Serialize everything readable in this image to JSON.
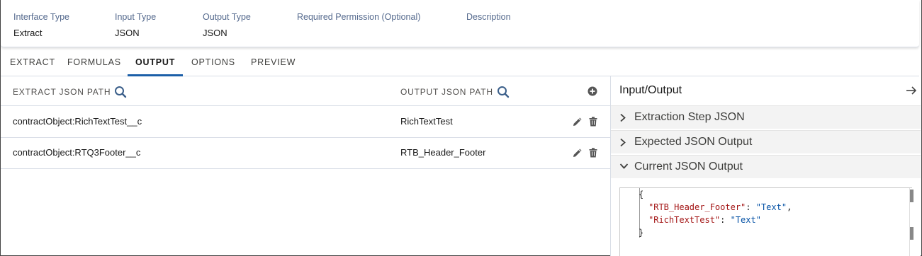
{
  "header": {
    "fields": [
      {
        "label": "Interface Type",
        "value": "Extract"
      },
      {
        "label": "Input Type",
        "value": "JSON"
      },
      {
        "label": "Output Type",
        "value": "JSON"
      },
      {
        "label": "Required Permission (Optional)",
        "value": ""
      },
      {
        "label": "Description",
        "value": ""
      }
    ]
  },
  "tabs": [
    {
      "label": "EXTRACT",
      "active": false
    },
    {
      "label": "FORMULAS",
      "active": false
    },
    {
      "label": "OUTPUT",
      "active": true
    },
    {
      "label": "OPTIONS",
      "active": false
    },
    {
      "label": "PREVIEW",
      "active": false
    }
  ],
  "grid": {
    "columns": [
      "EXTRACT JSON PATH",
      "OUTPUT JSON PATH"
    ],
    "rows": [
      {
        "extract_path": "contractObject:RichTextTest__c",
        "output_path": "RichTextTest"
      },
      {
        "extract_path": "contractObject:RTQ3Footer__c",
        "output_path": "RTB_Header_Footer"
      }
    ]
  },
  "panel": {
    "title": "Input/Output",
    "sections": [
      {
        "label": "Extraction Step JSON",
        "expanded": false
      },
      {
        "label": "Expected JSON Output",
        "expanded": false
      },
      {
        "label": "Current JSON Output",
        "expanded": true
      }
    ],
    "code": {
      "open": "{",
      "line1_key": "\"RTB_Header_Footer\"",
      "line1_value": "\"Text\"",
      "line2_key": "\"RichTextTest\"",
      "line2_value": "\"Text\"",
      "close": "}"
    }
  },
  "icons": {
    "search": "search-icon",
    "add": "add-icon",
    "edit": "edit-icon",
    "delete": "delete-icon",
    "arrow": "arrow-right-icon",
    "chevron_right": "chevron-right-icon",
    "chevron_down": "chevron-down-icon"
  },
  "colors": {
    "accent": "#1b5fa8",
    "icon": "#3b5f8a",
    "json_key": "#a31515",
    "json_string": "#0451a5"
  }
}
